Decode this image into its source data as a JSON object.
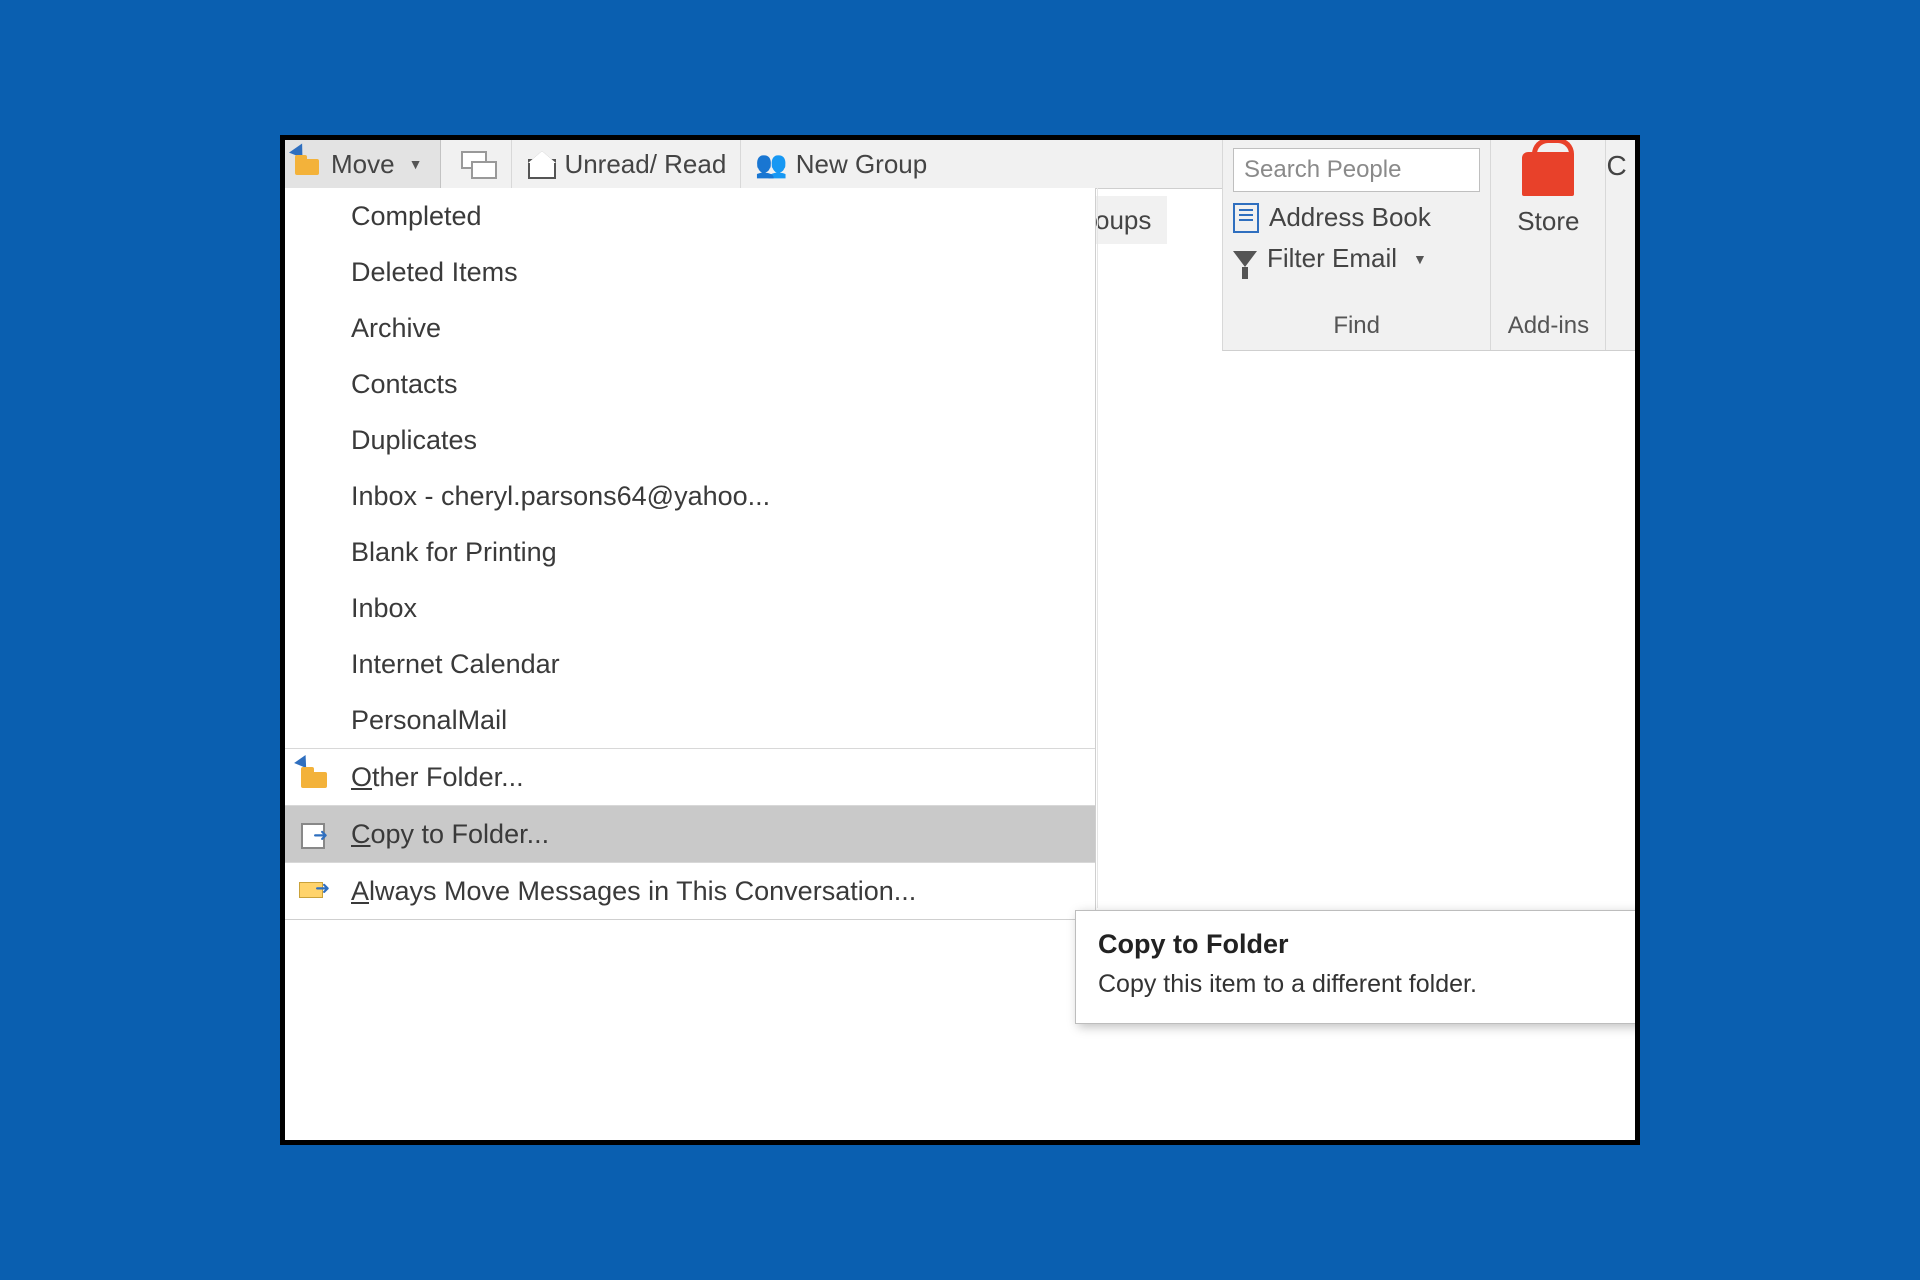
{
  "ribbon": {
    "move_label": "Move",
    "unread_read_label": "Unread/ Read",
    "new_group_label": "New Group",
    "groups_tail": "oups",
    "edge_letter": "C"
  },
  "find": {
    "search_placeholder": "Search People",
    "address_book_label": "Address Book",
    "filter_email_label": "Filter Email",
    "group_label": "Find"
  },
  "addins": {
    "store_label": "Store",
    "group_label": "Add-ins"
  },
  "menu": {
    "items": [
      "Completed",
      "Deleted Items",
      "Archive",
      "Contacts",
      "Duplicates",
      "Inbox - cheryl.parsons64@yahoo...",
      "Blank for Printing",
      "Inbox",
      "Internet Calendar",
      "PersonalMail"
    ],
    "other_folder": "Other Folder...",
    "copy_to_folder": "Copy to Folder...",
    "always_move": "Always Move Messages in This Conversation..."
  },
  "tooltip": {
    "title": "Copy to Folder",
    "body": "Copy this item to a different folder."
  }
}
